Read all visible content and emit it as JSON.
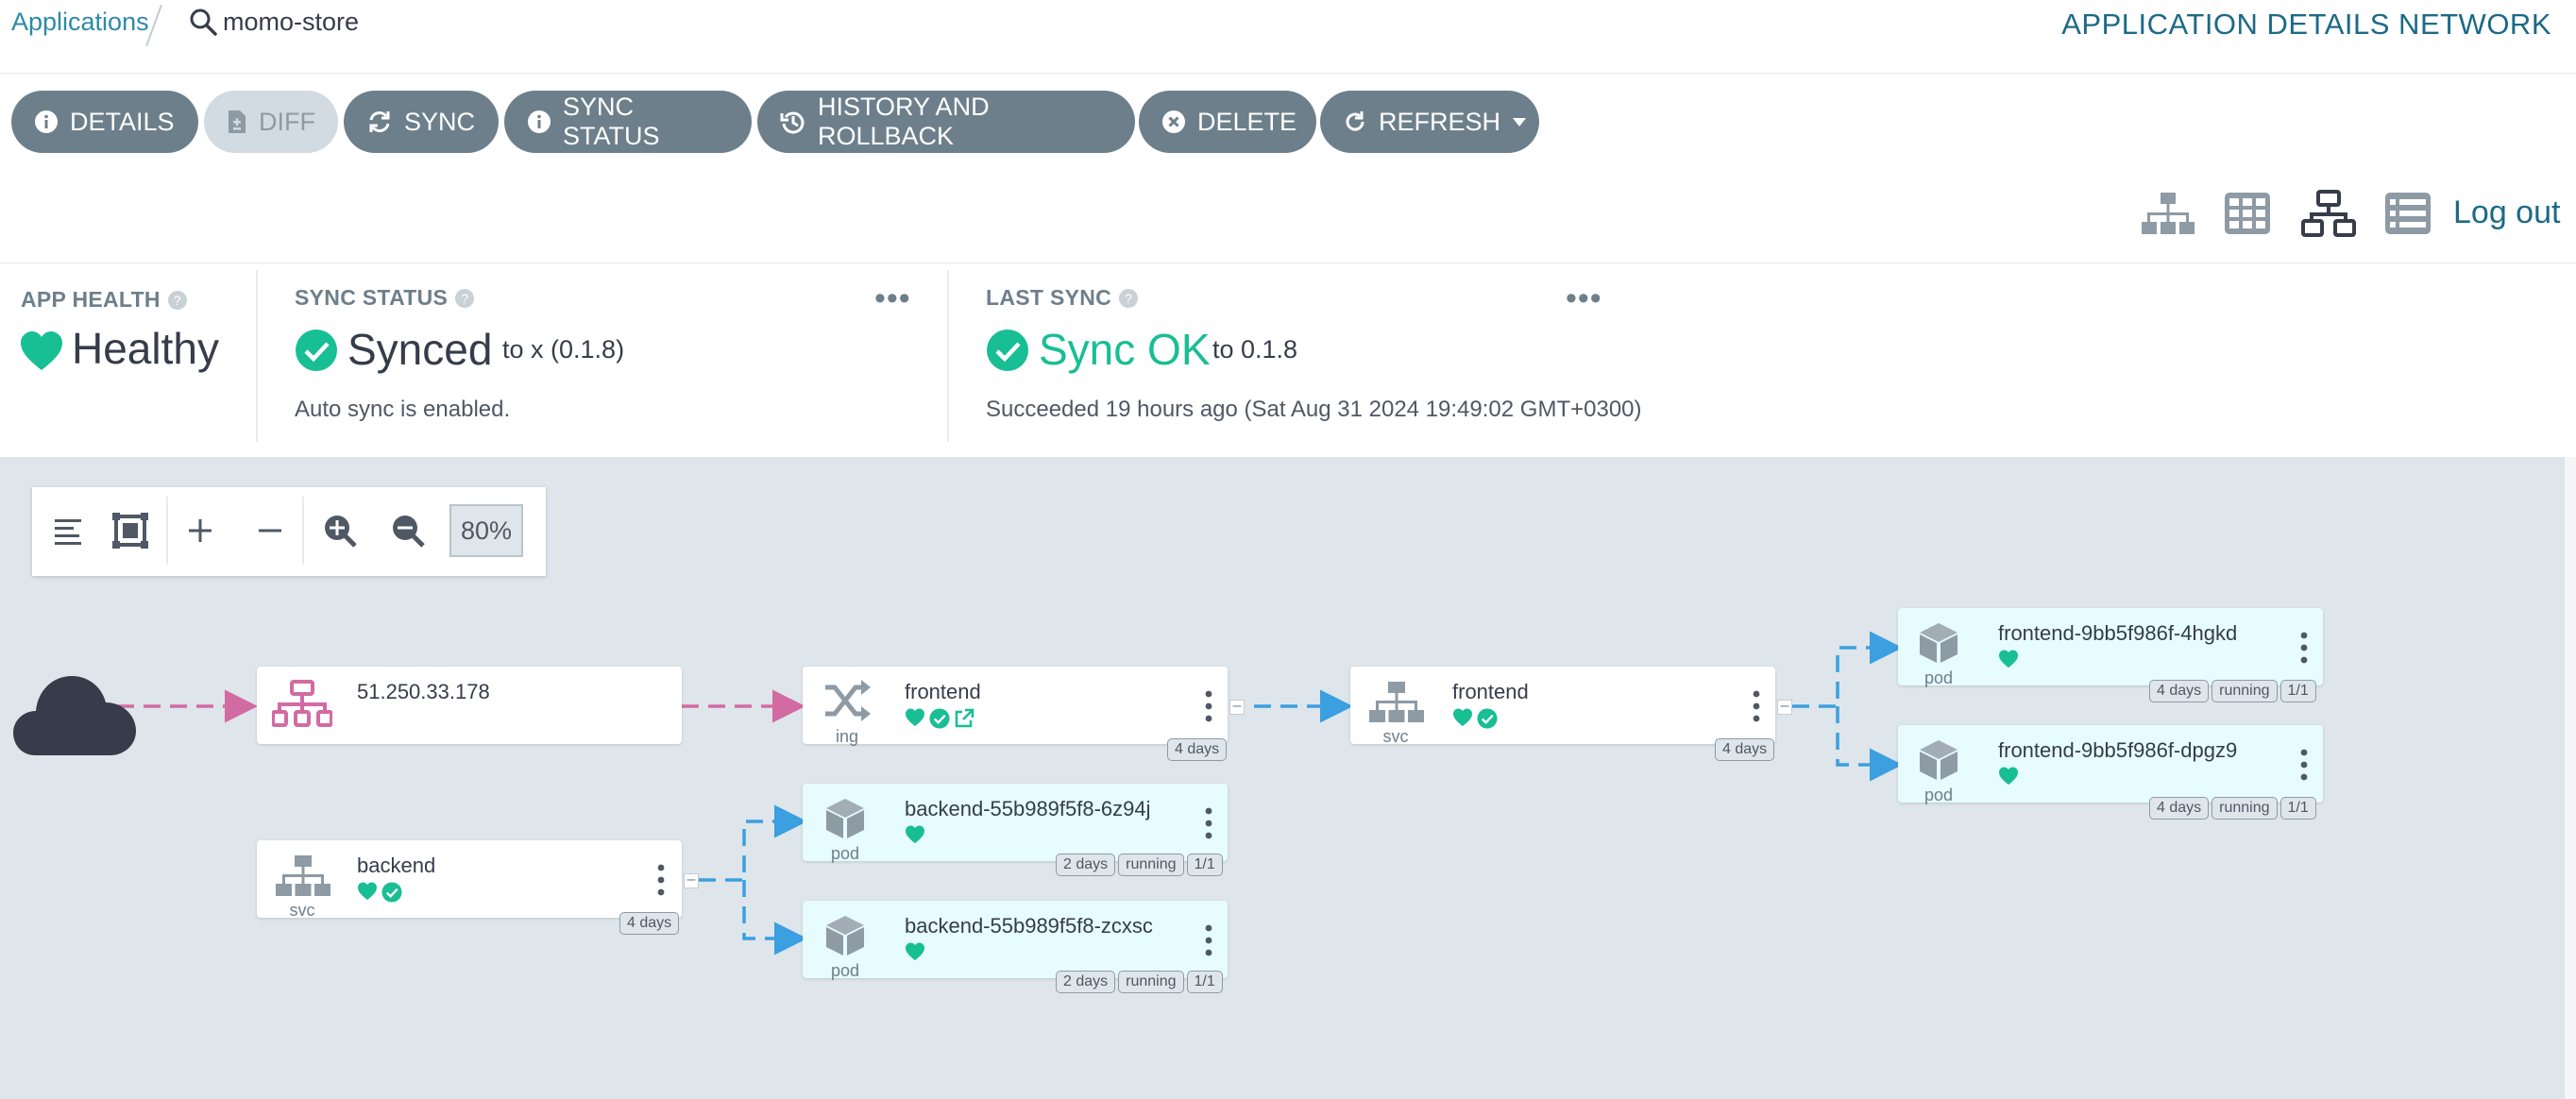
{
  "breadcrumb": {
    "applications": "Applications",
    "app_name": "momo-store"
  },
  "page_title": "APPLICATION DETAILS NETWORK",
  "toolbar": {
    "details": "DETAILS",
    "diff": "DIFF",
    "sync": "SYNC",
    "sync_status": "SYNC STATUS",
    "history": "HISTORY AND ROLLBACK",
    "delete": "DELETE",
    "refresh": "REFRESH"
  },
  "view_icons": [
    "tree-view-icon",
    "pods-view-icon",
    "network-view-icon",
    "list-view-icon"
  ],
  "logout": "Log out",
  "status": {
    "app_health": {
      "label": "APP HEALTH",
      "value": "Healthy"
    },
    "sync_status": {
      "label": "SYNC STATUS",
      "value": "Synced",
      "target": "to x (0.1.8)",
      "note": "Auto sync is enabled."
    },
    "last_sync": {
      "label": "LAST SYNC",
      "value": "Sync OK",
      "target": "to 0.1.8",
      "note": "Succeeded 19 hours ago (Sat Aug 31 2024 19:49:02 GMT+0300)"
    }
  },
  "graph": {
    "zoom": "80%",
    "nodes": {
      "lb": {
        "title": "51.250.33.178"
      },
      "ingress": {
        "title": "frontend",
        "kind": "ing",
        "age": "4 days"
      },
      "svc_frontend": {
        "title": "frontend",
        "kind": "svc",
        "age": "4 days"
      },
      "pod_fe1": {
        "title": "frontend-9bb5f986f-4hgkd",
        "kind": "pod",
        "age": "4 days",
        "status": "running",
        "ready": "1/1"
      },
      "pod_fe2": {
        "title": "frontend-9bb5f986f-dpgz9",
        "kind": "pod",
        "age": "4 days",
        "status": "running",
        "ready": "1/1"
      },
      "svc_backend": {
        "title": "backend",
        "kind": "svc",
        "age": "4 days"
      },
      "pod_be1": {
        "title": "backend-55b989f5f8-6z94j",
        "kind": "pod",
        "age": "2 days",
        "status": "running",
        "ready": "1/1"
      },
      "pod_be2": {
        "title": "backend-55b989f5f8-zcxsc",
        "kind": "pod",
        "age": "2 days",
        "status": "running",
        "ready": "1/1"
      }
    }
  },
  "colors": {
    "healthy": "#18be94",
    "accent": "#1c6a86",
    "button": "#6d7f8b",
    "ingress_pink": "#d36ba3",
    "edge_blue": "#3b9fe0",
    "graph_bg": "#dee6eb"
  }
}
